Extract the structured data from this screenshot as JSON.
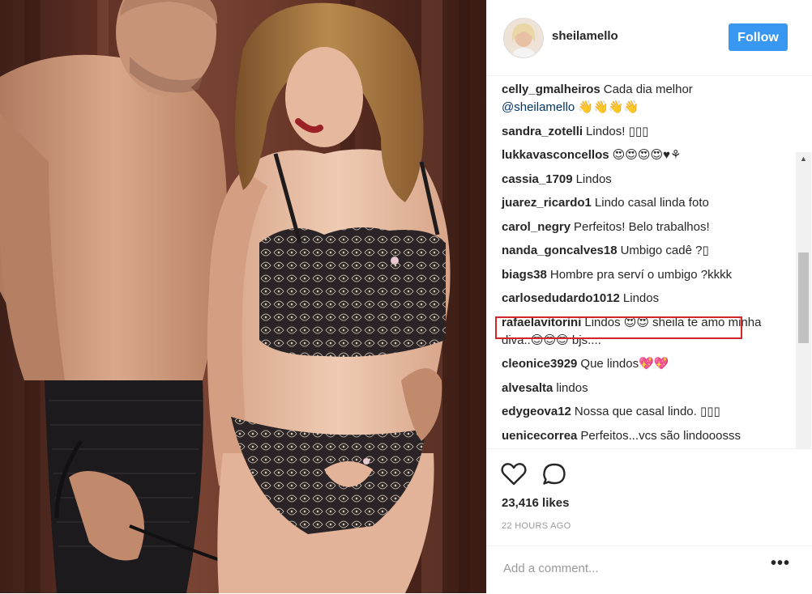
{
  "post": {
    "username": "sheilamello",
    "follow_label": "Follow",
    "likes": "23,416 likes",
    "time": "22 HOURS AGO",
    "comment_placeholder": "Add a comment...",
    "more_label": "•••"
  },
  "comments": [
    {
      "user": "celly_gmalheiros",
      "text": "Cada dia melhor",
      "mention": "@sheilamello",
      "suffix": " 👋👋👋👋"
    },
    {
      "user": "sandra_zotelli",
      "text": "Lindos! ▯▯▯"
    },
    {
      "user": "lukkavasconcellos",
      "text": "😍😍😍😍♥⚘"
    },
    {
      "user": "cassia_1709",
      "text": "Lindos"
    },
    {
      "user": "juarez_ricardo1",
      "text": "Lindo casal linda foto"
    },
    {
      "user": "carol_negry",
      "text": "Perfeitos! Belo trabalhos!"
    },
    {
      "user": "nanda_goncalves18",
      "text": "Umbigo cadê ?▯"
    },
    {
      "user": "biags38",
      "text": "Hombre pra serví o umbigo ?kkkk"
    },
    {
      "user": "carlosedudardo1012",
      "text": "Lindos"
    },
    {
      "user": "rafaelavitorini",
      "text": "Lindos 😍😍 sheila te amo minha diva..😍😍😍 bjs...."
    },
    {
      "user": "cleonice3929",
      "text": "Que lindos💖💖"
    },
    {
      "user": "alvesalta",
      "text": "lindos"
    },
    {
      "user": "edygeova12",
      "text": "Nossa que casal lindo. ▯▯▯"
    },
    {
      "user": "uenicecorrea",
      "text": "Perfeitos...vcs são lindooosss"
    }
  ],
  "icons": {
    "like": "heart-icon",
    "comment": "speech-bubble-icon",
    "more": "ellipsis-icon"
  },
  "colors": {
    "follow_button": "#3897f0",
    "highlight_box": "#d4252b"
  }
}
